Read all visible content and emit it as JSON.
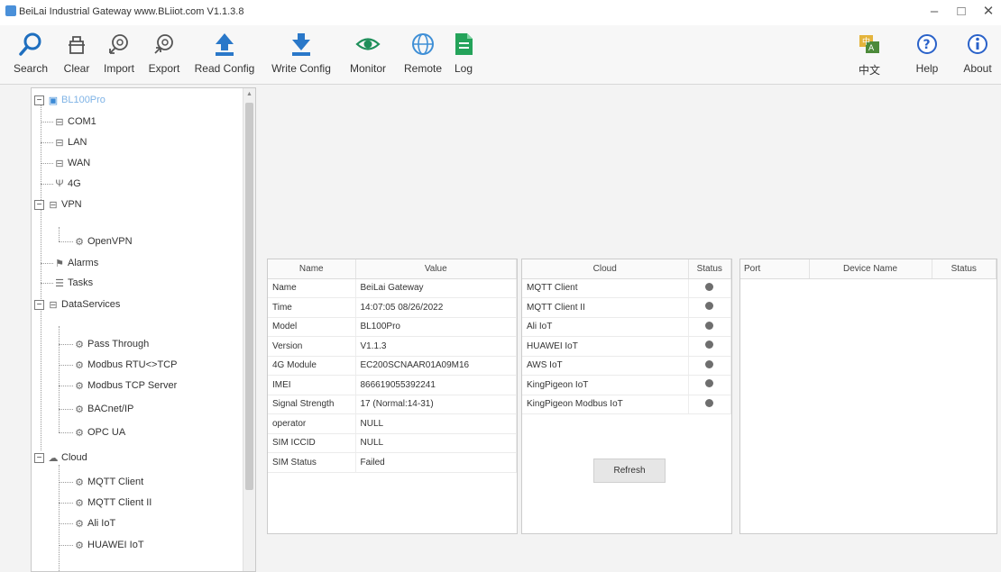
{
  "window": {
    "title": "BeiLai Industrial Gateway www.BLiiot.com V1.1.3.8",
    "min": "–",
    "max": "□",
    "close": "✕"
  },
  "toolbar": {
    "left": [
      {
        "label": "Search",
        "icon": "search-icon"
      },
      {
        "label": "Clear",
        "icon": "clear-icon"
      },
      {
        "label": "Import",
        "icon": "import-icon"
      },
      {
        "label": "Export",
        "icon": "export-icon"
      },
      {
        "label": "Read Config",
        "icon": "read-config-icon"
      },
      {
        "label": "Write Config",
        "icon": "write-config-icon"
      },
      {
        "label": "Monitor",
        "icon": "monitor-icon"
      },
      {
        "label": "Remote",
        "icon": "remote-icon"
      },
      {
        "label": "Log",
        "icon": "log-icon"
      }
    ],
    "right": [
      {
        "label": "中文",
        "icon": "language-icon"
      },
      {
        "label": "Help",
        "icon": "help-icon"
      },
      {
        "label": "About",
        "icon": "about-icon"
      }
    ]
  },
  "tree": {
    "root": "BL100Pro",
    "com1": "COM1",
    "lan": "LAN",
    "wan": "WAN",
    "g4": "4G",
    "vpn": "VPN",
    "openvpn": "OpenVPN",
    "alarms": "Alarms",
    "tasks": "Tasks",
    "dataservices": "DataServices",
    "passthrough": "Pass Through",
    "modbusrtu": "Modbus RTU<>TCP",
    "modbustcp": "Modbus TCP Server",
    "bacnet": "BACnet/IP",
    "opcua": "OPC UA",
    "cloud": "Cloud",
    "mqtt": "MQTT Client",
    "mqtt2": "MQTT Client II",
    "ali": "Ali IoT",
    "huawei": "HUAWEI IoT"
  },
  "info_table": {
    "headers": [
      "Name",
      "Value"
    ],
    "rows": [
      [
        "Name",
        "BeiLai Gateway"
      ],
      [
        "Time",
        "14:07:05 08/26/2022"
      ],
      [
        "Model",
        "BL100Pro"
      ],
      [
        "Version",
        "V1.1.3"
      ],
      [
        "4G Module",
        "EC200SCNAAR01A09M16"
      ],
      [
        "IMEI",
        "866619055392241"
      ],
      [
        "Signal Strength",
        "17 (Normal:14-31)"
      ],
      [
        "operator",
        "NULL"
      ],
      [
        "SIM ICCID",
        "NULL"
      ],
      [
        "SIM Status",
        "Failed"
      ]
    ]
  },
  "cloud_table": {
    "headers": [
      "Cloud",
      "Status"
    ],
    "rows": [
      "MQTT Client",
      "MQTT Client II",
      "Ali IoT",
      "HUAWEI IoT",
      "AWS IoT",
      "KingPigeon IoT",
      "KingPigeon Modbus IoT"
    ],
    "status_color": "#6e6e6e"
  },
  "device_table": {
    "headers": [
      "Port",
      "Device Name",
      "Status"
    ]
  },
  "refresh_label": "Refresh"
}
